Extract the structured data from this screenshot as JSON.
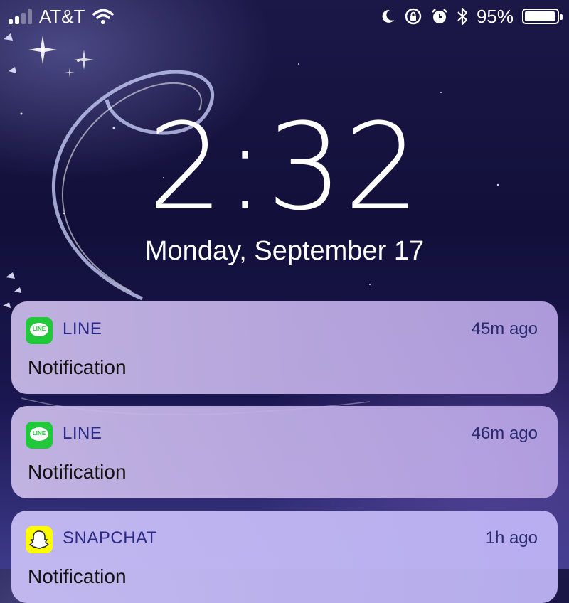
{
  "status_bar": {
    "carrier": "AT&T",
    "battery_percent": "95%",
    "battery_level": 0.95,
    "signal_bars_active": 2,
    "signal_bars_total": 4,
    "icons": [
      "signal-icon",
      "wifi-icon",
      "moon-icon",
      "rotation-lock-icon",
      "alarm-icon",
      "bluetooth-icon",
      "battery-icon"
    ]
  },
  "lockscreen": {
    "time": "2:32",
    "date": "Monday, September 17"
  },
  "notifications": [
    {
      "app": "LINE",
      "time_ago": "45m ago",
      "body": "Notification",
      "icon": "line-app-icon"
    },
    {
      "app": "LINE",
      "time_ago": "46m ago",
      "body": "Notification",
      "icon": "line-app-icon"
    },
    {
      "app": "SNAPCHAT",
      "time_ago": "1h ago",
      "body": "Notification",
      "icon": "snapchat-app-icon"
    }
  ],
  "line_icon_text": "LINE",
  "colors": {
    "line_green": "#21c83a",
    "snapchat_yellow": "#fffc00",
    "app_name_blue": "#2a2a8a"
  }
}
